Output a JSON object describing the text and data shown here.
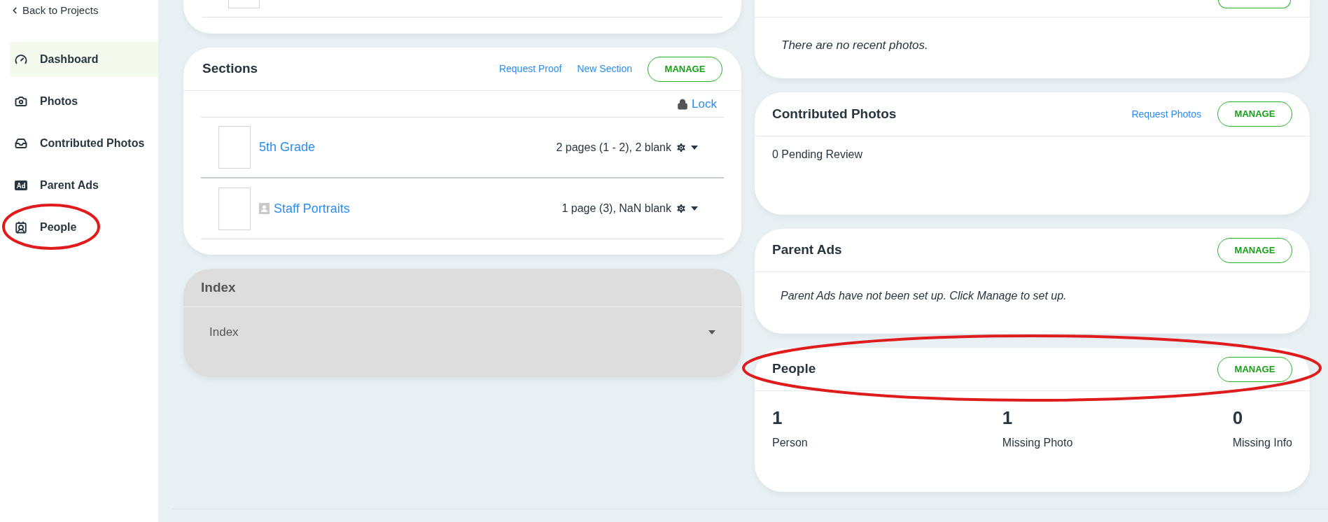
{
  "sidebar": {
    "back_link": "Back to Projects",
    "items": [
      {
        "label": "Dashboard",
        "kind": "dashboard",
        "selected": true
      },
      {
        "label": "Photos",
        "kind": "photos",
        "selected": false
      },
      {
        "label": "Contributed Photos",
        "kind": "contributed",
        "selected": false
      },
      {
        "label": "Parent Ads",
        "kind": "ads",
        "selected": false
      },
      {
        "label": "People",
        "kind": "people",
        "selected": false
      }
    ]
  },
  "sections": {
    "title": "Sections",
    "links": [
      "Request Proof",
      "New Section"
    ],
    "button": "MANAGE",
    "lock": "Lock",
    "rows": [
      {
        "name": "5th Grade",
        "portrait": false,
        "info": "2 pages (1 - 2), 2 blank"
      },
      {
        "name": "Staff Portraits",
        "portrait": true,
        "info": "1 page (3), NaN blank"
      }
    ]
  },
  "index": {
    "title": "Index",
    "select": "Index",
    "disabled": true
  },
  "recent_photos": {
    "message": "There are no recent photos."
  },
  "contributed_photos": {
    "title": "Contributed Photos",
    "link": "Request Photos",
    "button": "MANAGE",
    "status": "0 Pending Review"
  },
  "parent_ads": {
    "title": "Parent Ads",
    "button": "MANAGE",
    "message": "Parent Ads have not been set up. Click Manage to set up."
  },
  "people": {
    "title": "People",
    "button": "MANAGE",
    "stats": [
      {
        "value": "1",
        "label": "Person"
      },
      {
        "value": "1",
        "label": "Missing Photo"
      },
      {
        "value": "0",
        "label": "Missing Info"
      }
    ]
  }
}
